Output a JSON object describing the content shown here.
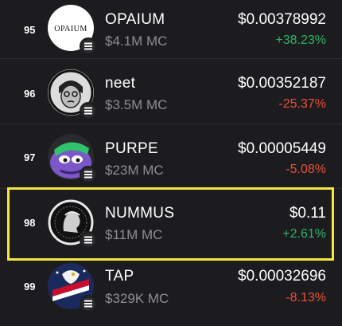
{
  "tokens": [
    {
      "rank": "95",
      "name": "OPAIUM",
      "mc": "$4.1M MC",
      "price": "$0.00378992",
      "change": "+38.23%",
      "direction": "up",
      "logo_text": "OPAIUM"
    },
    {
      "rank": "96",
      "name": "neet",
      "mc": "$3.5M MC",
      "price": "$0.00352187",
      "change": "-25.37%",
      "direction": "down"
    },
    {
      "rank": "97",
      "name": "PURPE",
      "mc": "$23M MC",
      "price": "$0.00005449",
      "change": "-5.08%",
      "direction": "down"
    },
    {
      "rank": "98",
      "name": "NUMMUS",
      "mc": "$11M MC",
      "price": "$0.11",
      "change": "+2.61%",
      "direction": "up"
    },
    {
      "rank": "99",
      "name": "TAP",
      "mc": "$329K MC",
      "price": "$0.00032696",
      "change": "-8.13%",
      "direction": "down"
    }
  ],
  "colors": {
    "background": "#1c1c1e",
    "positive": "#30b26a",
    "negative": "#e8503a",
    "highlight": "#f5e642",
    "muted": "#8e8e93"
  },
  "icons": {
    "chain": "solana-icon"
  }
}
